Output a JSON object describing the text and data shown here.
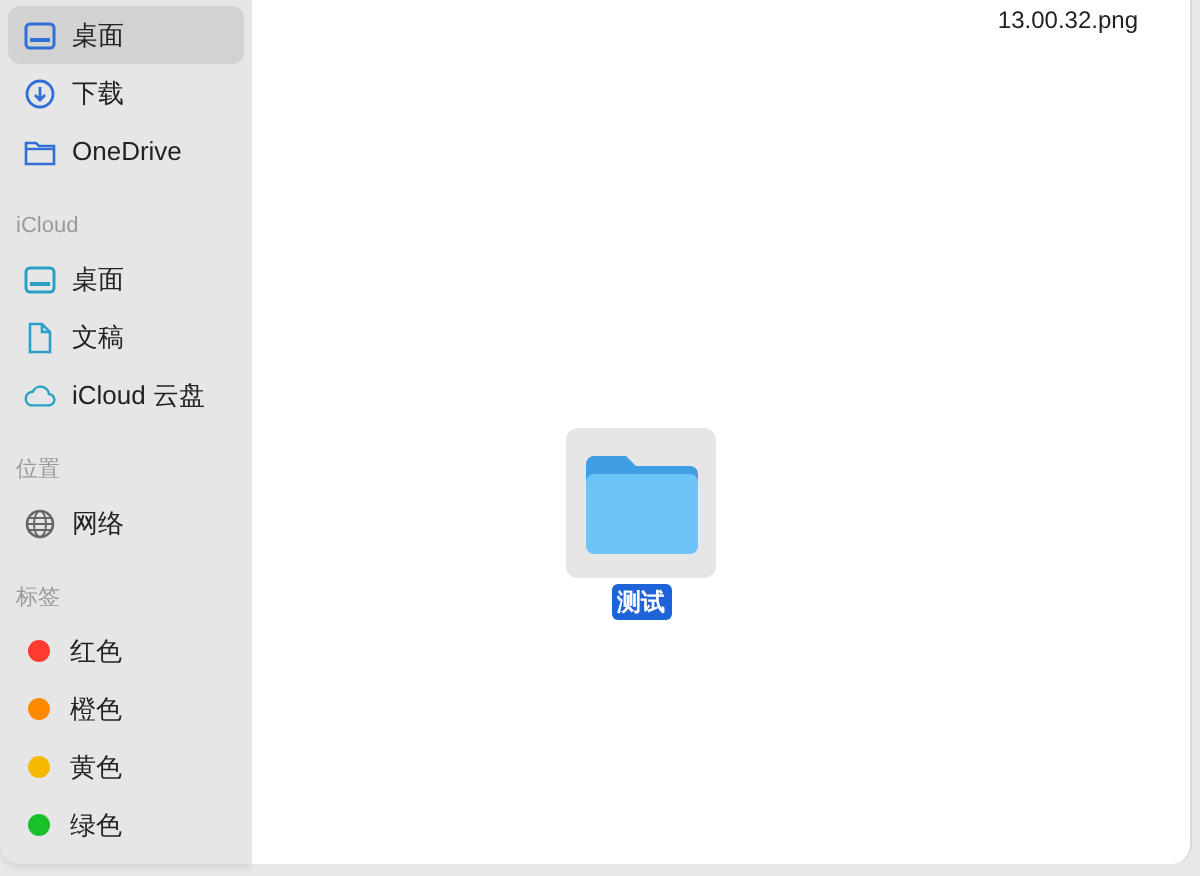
{
  "sidebar": {
    "sections": [
      {
        "items": [
          {
            "kind": "desktop",
            "label": "桌面",
            "selected": true
          },
          {
            "kind": "download",
            "label": "下载",
            "selected": false
          },
          {
            "kind": "folder",
            "label": "OneDrive",
            "selected": false
          }
        ]
      },
      {
        "header": "iCloud",
        "items": [
          {
            "kind": "desktop-cloud",
            "label": "桌面",
            "selected": false
          },
          {
            "kind": "document",
            "label": "文稿",
            "selected": false
          },
          {
            "kind": "cloud",
            "label": "iCloud 云盘",
            "selected": false
          }
        ]
      },
      {
        "header": "位置",
        "items": [
          {
            "kind": "network",
            "label": "网络",
            "selected": false
          }
        ]
      },
      {
        "header": "标签",
        "items": [
          {
            "kind": "tag",
            "label": "红色",
            "color": "#ff3b30",
            "selected": false
          },
          {
            "kind": "tag",
            "label": "橙色",
            "color": "#ff8a00",
            "selected": false
          },
          {
            "kind": "tag",
            "label": "黄色",
            "color": "#f5b800",
            "selected": false
          },
          {
            "kind": "tag",
            "label": "绿色",
            "color": "#19c02a",
            "selected": false
          }
        ]
      }
    ]
  },
  "content": {
    "partial_file_name": "13.00.32.png",
    "items": [
      {
        "kind": "folder",
        "name": "测试",
        "selected": true
      }
    ]
  }
}
